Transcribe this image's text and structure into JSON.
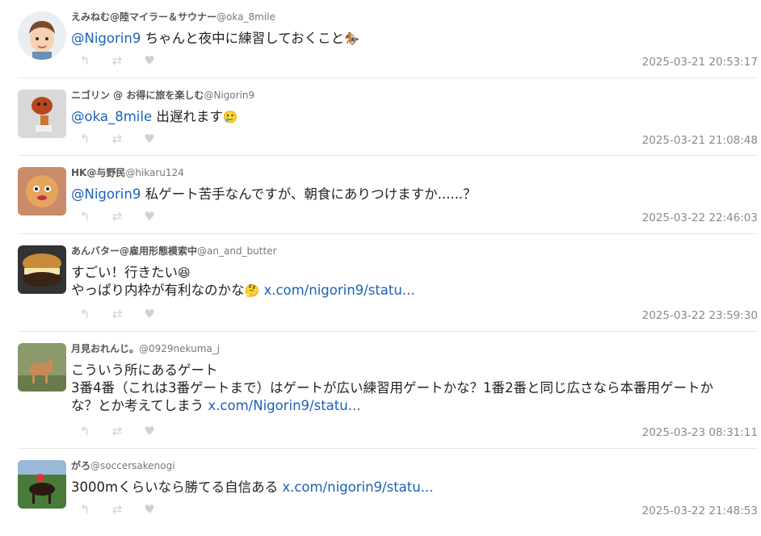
{
  "tweets": [
    {
      "name": "えみねむ@陸マイラー＆サウナー",
      "handle": "@oka_8mile",
      "mention": "@Nigorin9",
      "text": " ちゃんと夜中に練習しておくこと",
      "emoji": "🏇",
      "time": "2025-03-21 20:53:17"
    },
    {
      "name": "ニゴリン @ お得に旅を楽しむ",
      "handle": "@Nigorin9",
      "mention": "@oka_8mile",
      "text": " 出遅れます",
      "emoji": "🥲",
      "time": "2025-03-21 21:08:48"
    },
    {
      "name": "HK@与野民",
      "handle": "@hikaru124",
      "mention": "@Nigorin9",
      "text": " 私ゲート苦手なんですが、朝食にありつけますか......？",
      "time": "2025-03-22 22:46:03"
    },
    {
      "name": "あんバター@雇用形態模索中",
      "handle": "@an_and_butter",
      "line1": "すごい！行きたい",
      "emoji1": "😆",
      "line2": "やっぱり内枠が有利なのかな",
      "emoji2": "🤔",
      "link": "x.com/nigorin9/statu...",
      "time": "2025-03-22 23:59:30"
    },
    {
      "name": "月見おれんじ。",
      "handle": "@0929nekuma_j",
      "line1": "こういう所にあるゲート",
      "line2": "3番4番（これは3番ゲートまで）はゲートが広い練習用ゲートかな？1番2番と同じ広さなら本番用ゲートか",
      "line3": "な？とか考えてしまう ",
      "link": "x.com/Nigorin9/statu...",
      "time": "2025-03-23 08:31:11"
    },
    {
      "name": "がろ",
      "handle": "@soccersakenogi",
      "text": "3000mくらいなら勝てる自信ある ",
      "link": "x.com/nigorin9/statu...",
      "time": "2025-03-22 21:48:53"
    }
  ],
  "icons": [
    "reply-icon",
    "retweet-icon",
    "like-icon"
  ]
}
